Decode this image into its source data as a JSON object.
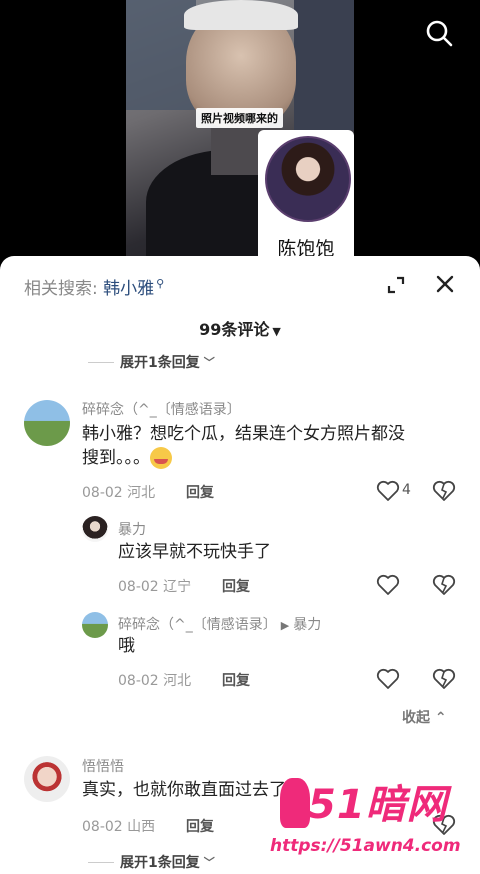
{
  "video": {
    "caption": "照片视频哪来的",
    "inset_name": "陈饱饱"
  },
  "header": {
    "related_label": "相关搜索:",
    "related_keyword": "韩小雅",
    "comment_count": "99条评论",
    "caret": "▼"
  },
  "thread": {
    "top_expand": "展开1条回复",
    "comments": [
      {
        "name": "碎碎念（^_〔情感语录〕",
        "text_line1": "韩小雅？想吃个瓜，结果连个女方照片都没",
        "text_line2": "搜到。。。",
        "date": "08-02",
        "location": "河北",
        "reply": "回复",
        "likes": "4"
      },
      {
        "name": "暴力",
        "text": "应该早就不玩快手了",
        "date": "08-02",
        "location": "辽宁",
        "reply": "回复"
      },
      {
        "name": "碎碎念（^_〔情感语录〕",
        "reply_to": "暴力",
        "text": "哦",
        "date": "08-02",
        "location": "河北",
        "reply": "回复"
      }
    ],
    "collapse": "收起 ⌃"
  },
  "comment2": {
    "name": "悟悟悟",
    "text": "真实，也就你敢直面过去了",
    "tail": "，",
    "date": "08-02",
    "location": "山西",
    "reply": "回复",
    "expand": "展开1条回复"
  },
  "watermark": {
    "logo": "51暗网",
    "url": "https://51awn4.com"
  },
  "icons": {
    "search": "search-icon",
    "expand": "expand-icon",
    "close": "close-icon",
    "like": "heart-icon",
    "dislike": "broken-heart-icon"
  },
  "colors": {
    "accent": "#2c4d7c",
    "watermark": "#ef2a7a"
  }
}
